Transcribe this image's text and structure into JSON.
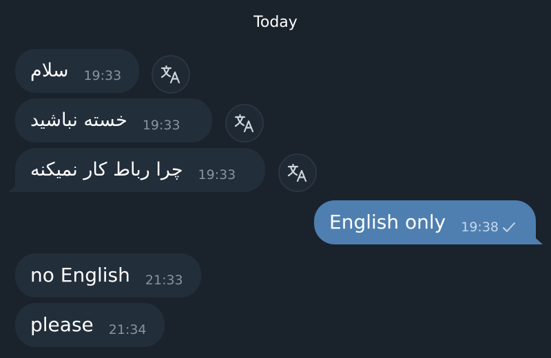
{
  "chat": {
    "date_header": "Today",
    "messages": [
      {
        "text": "سلام",
        "time": "19:33",
        "direction": "incoming",
        "translatable": true
      },
      {
        "text": "خسته نباشید",
        "time": "19:33",
        "direction": "incoming",
        "translatable": true
      },
      {
        "text": "چرا رباط کار نمیکنه",
        "time": "19:33",
        "direction": "incoming",
        "translatable": true
      },
      {
        "text": "English only",
        "time": "19:38",
        "direction": "outgoing",
        "status": "sent"
      },
      {
        "text": "no English",
        "time": "21:33",
        "direction": "incoming"
      },
      {
        "text": "please",
        "time": "21:34",
        "direction": "incoming"
      }
    ]
  },
  "icons": {
    "translate": "translate-icon",
    "sent_status": "single-check-icon"
  },
  "colors": {
    "background": "#1a222c",
    "incoming_bubble": "#222e3a",
    "outgoing_bubble": "#4f7fb0",
    "timestamp": "#8a949e",
    "text": "#ffffff"
  }
}
